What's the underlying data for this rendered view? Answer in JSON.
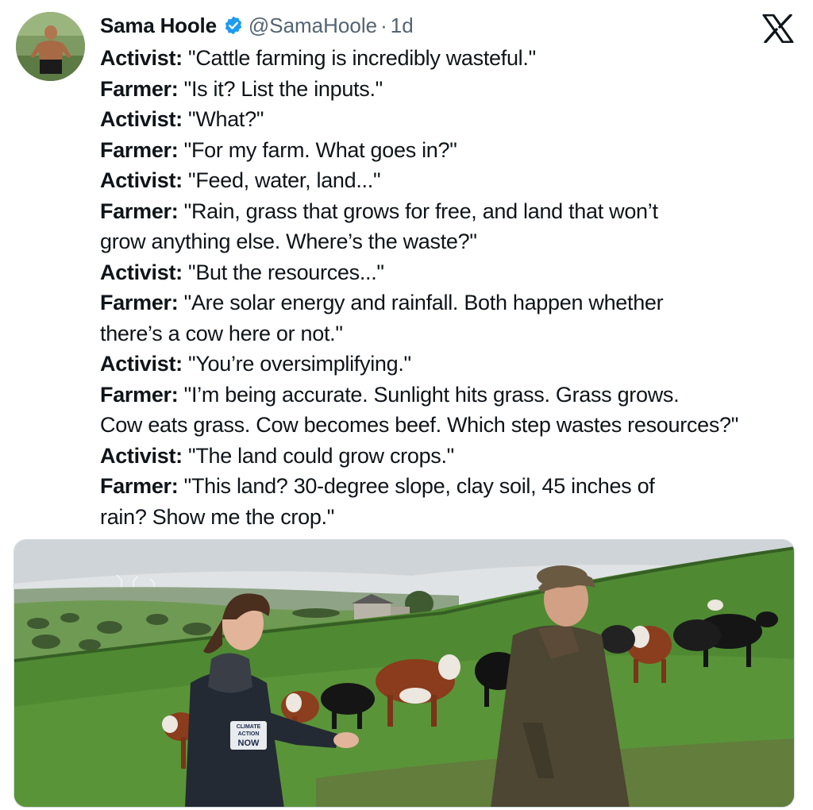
{
  "post": {
    "author_name": "Sama Hoole",
    "author_handle": "@SamaHoole",
    "separator": "·",
    "timestamp": "1d",
    "platform_logo": "x-logo-icon",
    "verified_icon": "verified-badge-icon",
    "lines": [
      {
        "speaker": "Activist:",
        "text": " \"Cattle farming is incredibly wasteful.\""
      },
      {
        "speaker": "Farmer:",
        "text": " \"Is it? List the inputs.\""
      },
      {
        "speaker": "Activist:",
        "text": " \"What?\""
      },
      {
        "speaker": "Farmer:",
        "text": " \"For my farm. What goes in?\""
      },
      {
        "speaker": "Activist:",
        "text": " \"Feed, water, land...\""
      },
      {
        "speaker": "Farmer:",
        "text": " \"Rain, grass that grows for free, and land that won’t"
      },
      {
        "speaker": "",
        "text": "grow anything else. Where’s the waste?\""
      },
      {
        "speaker": "Activist:",
        "text": " \"But the resources...\""
      },
      {
        "speaker": "Farmer:",
        "text": " \"Are solar energy and rainfall. Both happen whether"
      },
      {
        "speaker": "",
        "text": "there’s a cow here or not.\""
      },
      {
        "speaker": "Activist:",
        "text": " \"You’re oversimplifying.\""
      },
      {
        "speaker": "Farmer:",
        "text": " \"I’m being accurate. Sunlight hits grass. Grass grows."
      },
      {
        "speaker": "",
        "text": "Cow eats grass. Cow becomes beef. Which step wastes resources?\""
      },
      {
        "speaker": "Activist:",
        "text": " \"The land could grow crops.\""
      },
      {
        "speaker": "Farmer:",
        "text": " \"This land? 30-degree slope, clay soil, 45 inches of"
      },
      {
        "speaker": "",
        "text": "rain? Show me the crop.\""
      }
    ]
  },
  "media": {
    "jacket_patch_lines": [
      "CLIMATE",
      "ACTION",
      "NOW"
    ],
    "colors": {
      "sky": "#dfe3e6",
      "grass": "#4f8a32",
      "jacket": "#232a33",
      "coat": "#4c4632"
    }
  }
}
